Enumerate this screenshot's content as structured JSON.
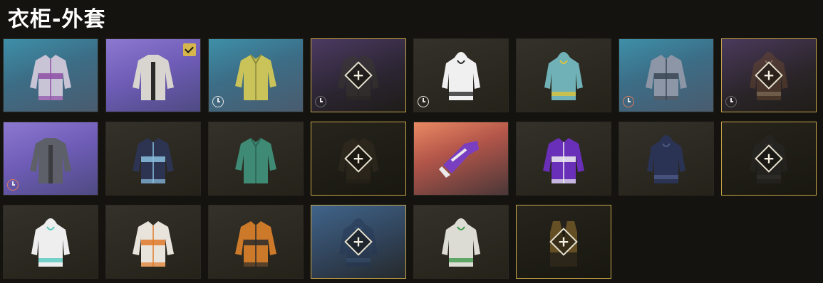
{
  "header": {
    "title": "衣柜-外套"
  },
  "items": [
    {
      "name": "purple-teal-jacket",
      "bg": "blue",
      "primary": "#c9c3d6",
      "accent": "#8e4fa6",
      "style": "jacket",
      "locked": false,
      "timer": "none",
      "equipped": false
    },
    {
      "name": "silver-jacket",
      "bg": "purple",
      "primary": "#d8d4cf",
      "accent": "#2a2a2a",
      "style": "open",
      "locked": false,
      "timer": "none",
      "equipped": true
    },
    {
      "name": "yellow-shirt",
      "bg": "blue",
      "primary": "#c9c35a",
      "accent": "#8a8a3a",
      "style": "shirt",
      "locked": false,
      "timer": "white",
      "equipped": false
    },
    {
      "name": "dark-jacket-locked",
      "bg": "darkpurple",
      "primary": "#3b3a2c",
      "accent": "#2a2920",
      "style": "jacket",
      "locked": true,
      "timer": "faded",
      "equipped": false
    },
    {
      "name": "white-hoodie",
      "bg": "none",
      "primary": "#f0f0f0",
      "accent": "#2a2a2a",
      "style": "hoodie",
      "locked": false,
      "timer": "white",
      "equipped": false
    },
    {
      "name": "teal-hoodie",
      "bg": "none",
      "primary": "#6fb1b6",
      "accent": "#e0c43a",
      "style": "hoodie",
      "locked": false,
      "timer": "none",
      "equipped": false
    },
    {
      "name": "grey-bomber",
      "bg": "blue",
      "primary": "#8c96a6",
      "accent": "#3b4654",
      "style": "jacket",
      "locked": false,
      "timer": "red",
      "equipped": false
    },
    {
      "name": "camo-hoodie-locked",
      "bg": "darkbrown",
      "primary": "#6e4a2f",
      "accent": "#d9b888",
      "style": "hoodie",
      "locked": true,
      "timer": "faded",
      "equipped": false
    },
    {
      "name": "grey-leather-jacket",
      "bg": "purple",
      "primary": "#5d6068",
      "accent": "#3a3c40",
      "style": "open",
      "locked": false,
      "timer": "red",
      "equipped": false
    },
    {
      "name": "navy-sweater",
      "bg": "none",
      "primary": "#2d3452",
      "accent": "#8bc0e0",
      "style": "jacket",
      "locked": false,
      "timer": "none",
      "equipped": false
    },
    {
      "name": "green-shirt",
      "bg": "none",
      "primary": "#3f8a74",
      "accent": "#2c6353",
      "style": "shirt",
      "locked": false,
      "timer": "none",
      "equipped": false
    },
    {
      "name": "dark-bomber-locked",
      "bg": "none",
      "primary": "#3a3023",
      "accent": "#2a251c",
      "style": "jacket",
      "locked": true,
      "timer": "none",
      "equipped": false
    },
    {
      "name": "purple-sleeve",
      "bg": "orange",
      "primary": "#7a3fc0",
      "accent": "#eaeaea",
      "style": "sleeve",
      "locked": false,
      "timer": "none",
      "equipped": false
    },
    {
      "name": "purple-racer-jacket",
      "bg": "none",
      "primary": "#6a2fb8",
      "accent": "#f0f0f0",
      "style": "jacket",
      "locked": false,
      "timer": "none",
      "equipped": false
    },
    {
      "name": "navy-dress-coat",
      "bg": "none",
      "primary": "#2a3354",
      "accent": "#4e5a86",
      "style": "hoodie",
      "locked": false,
      "timer": "none",
      "equipped": false
    },
    {
      "name": "black-hoodie-locked",
      "bg": "none",
      "primary": "#2b2b2b",
      "accent": "#444444",
      "style": "hoodie",
      "locked": true,
      "timer": "none",
      "equipped": false
    },
    {
      "name": "white-teal-hoodie",
      "bg": "none",
      "primary": "#eeeeee",
      "accent": "#58c8c0",
      "style": "hoodie",
      "locked": false,
      "timer": "none",
      "equipped": false
    },
    {
      "name": "orange-white-jacket",
      "bg": "none",
      "primary": "#e8e4dc",
      "accent": "#e07a2a",
      "style": "jacket",
      "locked": false,
      "timer": "none",
      "equipped": false
    },
    {
      "name": "orange-jacket",
      "bg": "none",
      "primary": "#cc7a2a",
      "accent": "#2a2a2a",
      "style": "jacket",
      "locked": false,
      "timer": "none",
      "equipped": false
    },
    {
      "name": "navy-hoodie-locked",
      "bg": "darkblue",
      "primary": "#243552",
      "accent": "#3e5b7f",
      "style": "hoodie",
      "locked": true,
      "timer": "none",
      "equipped": false
    },
    {
      "name": "white-green-hoodie",
      "bg": "none",
      "primary": "#dcdcd4",
      "accent": "#3f9a4a",
      "style": "hoodie",
      "locked": false,
      "timer": "none",
      "equipped": false
    },
    {
      "name": "brown-vest-locked",
      "bg": "none",
      "primary": "#b88a36",
      "accent": "#2a2620",
      "style": "vest",
      "locked": true,
      "timer": "none",
      "equipped": false
    }
  ],
  "labels": {
    "add_symbol": "+"
  }
}
